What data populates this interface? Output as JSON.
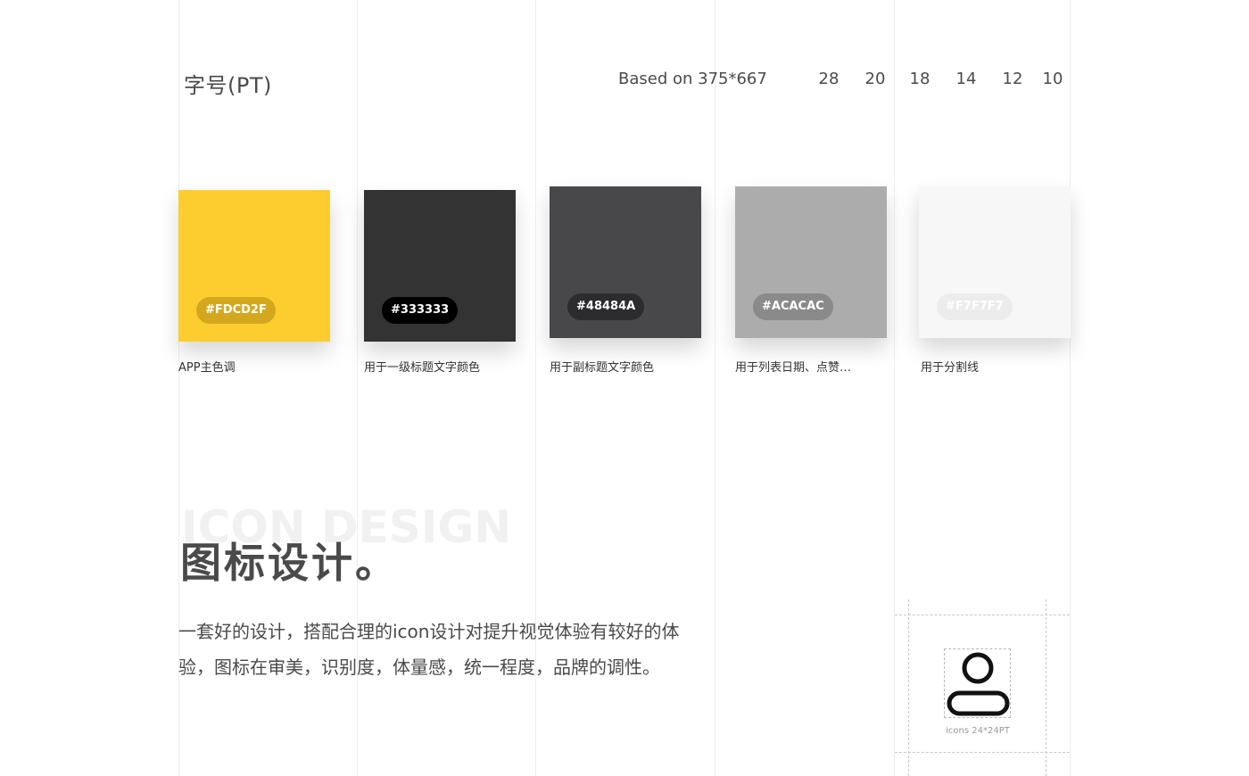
{
  "typography": {
    "title": "字号(PT)",
    "based_on": "Based on 375*667",
    "sizes": [
      "28",
      "20",
      "18",
      "14",
      "12",
      "10"
    ]
  },
  "colors": [
    {
      "hex": "#FDCD2F",
      "caption": "APP主色调",
      "chip_bg": "#d3a81e",
      "chip_text": "#ffffff"
    },
    {
      "hex": "#333333",
      "caption": "用于一级标题文字颜色",
      "chip_bg": "#000000",
      "chip_text": "#ffffff"
    },
    {
      "hex": "#48484A",
      "caption": "用于副标题文字颜色",
      "chip_bg": "#2c2c2e",
      "chip_text": "#ffffff"
    },
    {
      "hex": "#ACACAC",
      "caption": "用于列表日期、点赞…",
      "chip_bg": "#8a8a8a",
      "chip_text": "#ffffff"
    },
    {
      "hex": "#F7F7F7",
      "caption": "用于分割线",
      "chip_bg": "#ececec",
      "chip_text": "#ffffff"
    }
  ],
  "icon_section": {
    "watermark": "ICON DESIGN",
    "title": "图标设计。",
    "description_line1": "一套好的设计，搭配合理的icon设计对提升视觉体验有较好的体",
    "description_line2": "验，图标在审美，识别度，体量感，统一程度，品牌的调性。",
    "icon_name": "user-icon",
    "icon_caption": "icons 24*24PT"
  }
}
